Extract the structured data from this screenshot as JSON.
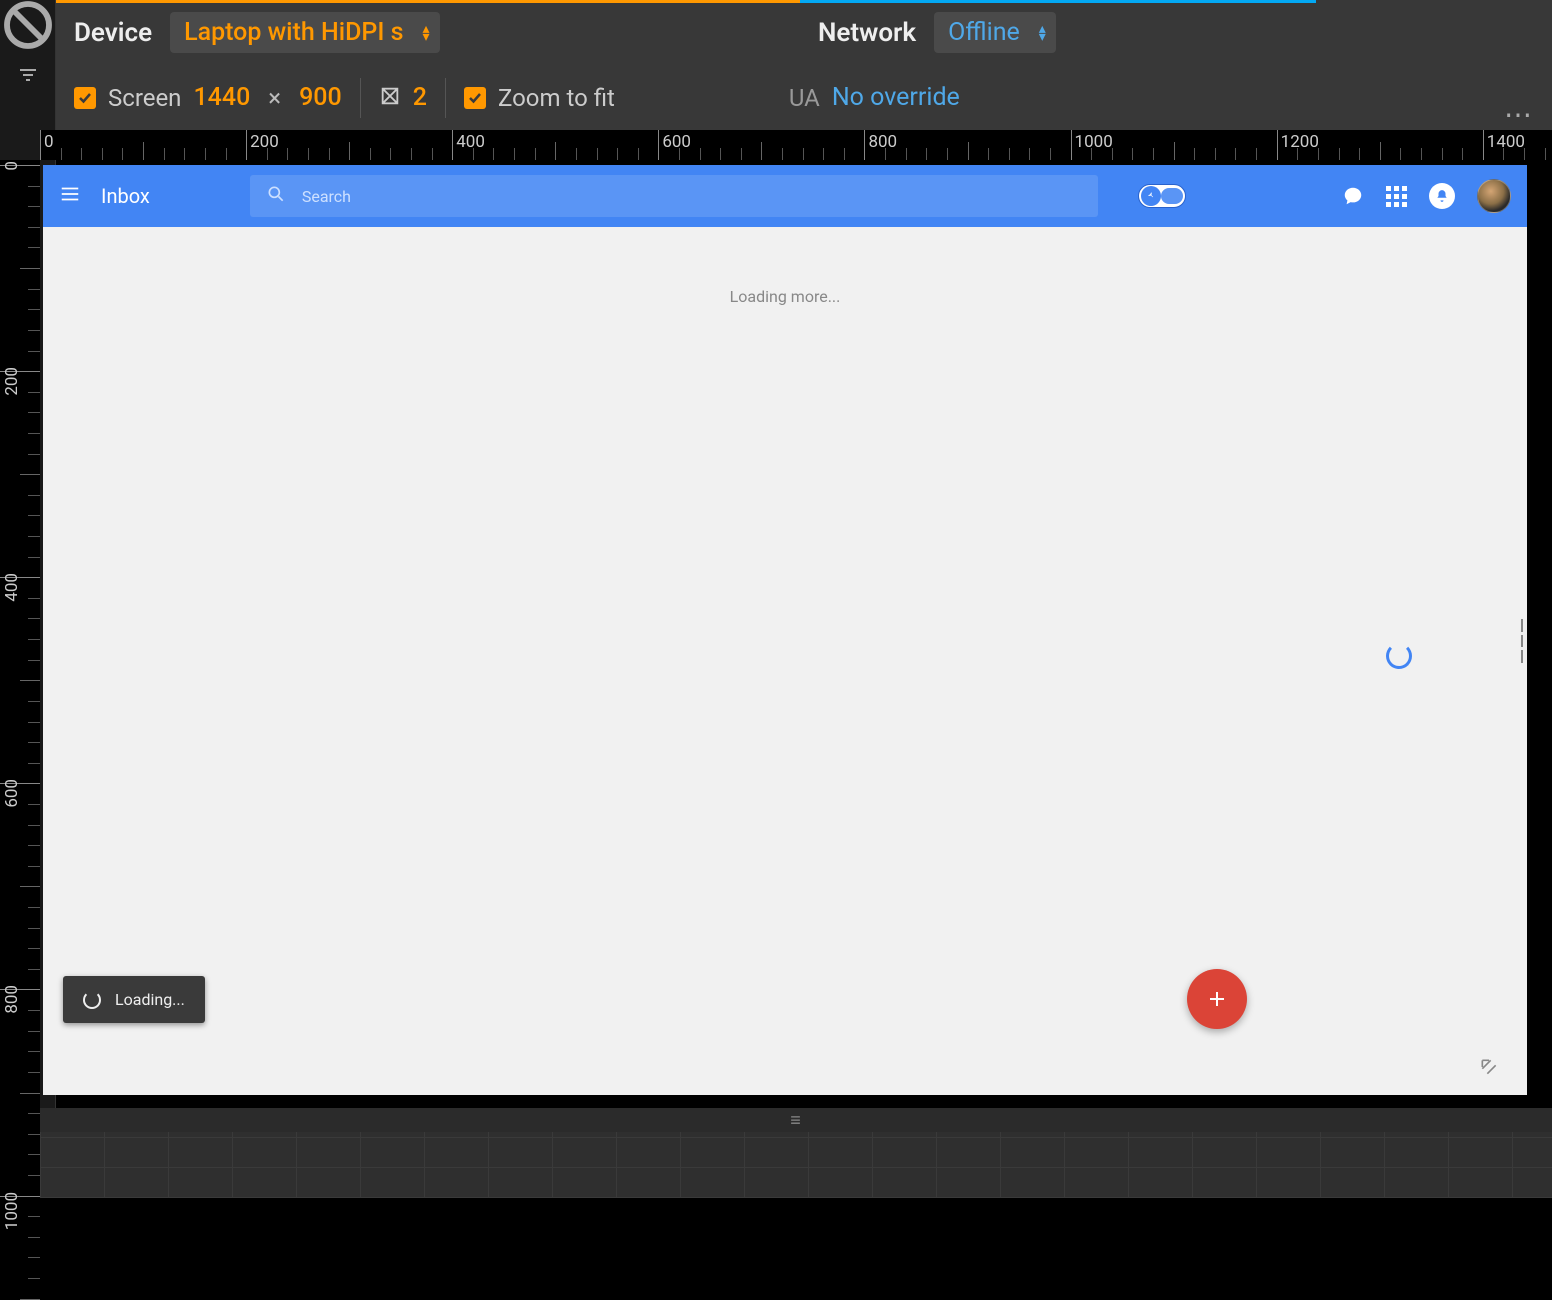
{
  "devtools": {
    "device_label": "Device",
    "device_preset": "Laptop with HiDPI s",
    "network_label": "Network",
    "network_preset": "Offline",
    "screen_label": "Screen",
    "width": "1440",
    "height": "900",
    "dpr": "2",
    "zoom_label": "Zoom to fit",
    "ua_label": "UA",
    "ua_value": "No override",
    "ruler_origin": "0"
  },
  "ruler_h": [
    0,
    200,
    400,
    600,
    800,
    1000,
    1200,
    1400
  ],
  "ruler_v": [
    0,
    200,
    400,
    600,
    800,
    1000
  ],
  "inbox": {
    "title": "Inbox",
    "search_placeholder": "Search",
    "loading_more": "Loading more...",
    "toast": "Loading..."
  }
}
